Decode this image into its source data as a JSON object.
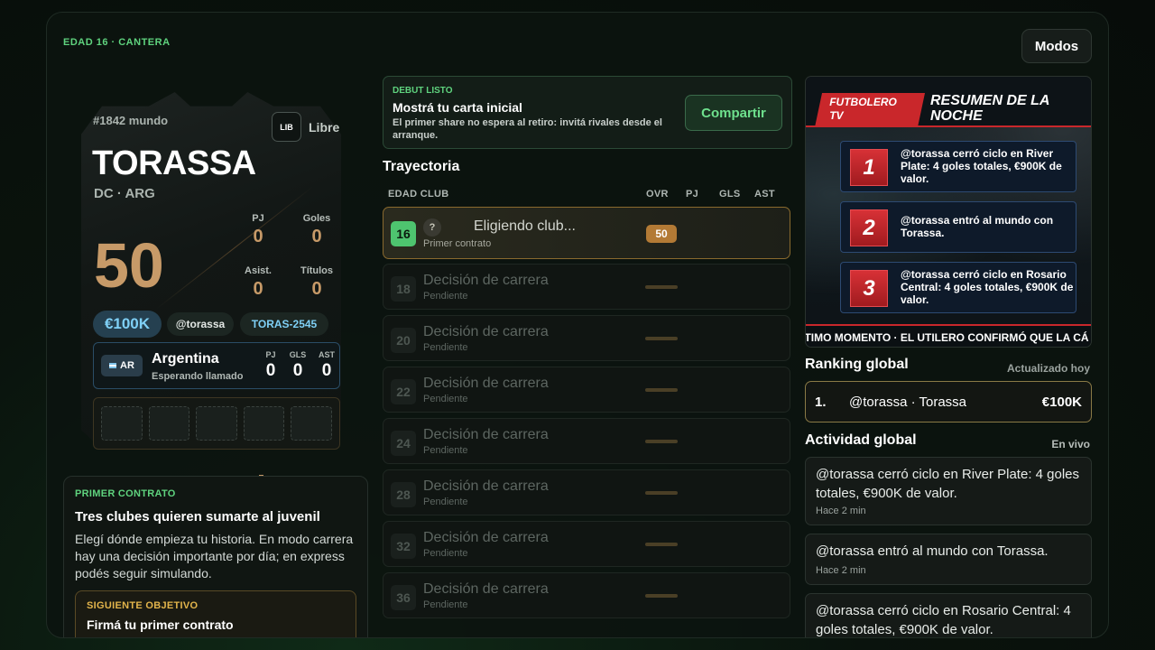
{
  "header": {
    "eyebrow": "EDAD 16 · CANTERA",
    "modes_label": "Modos"
  },
  "card": {
    "rank": "#1842 mundo",
    "position_badge": "LIB",
    "status": "Libre",
    "name": "TORASSA",
    "role_country": "DC · ARG",
    "overall": "50",
    "stats": [
      {
        "label": "PJ",
        "value": "0"
      },
      {
        "label": "Goles",
        "value": "0"
      },
      {
        "label": "Asist.",
        "value": "0"
      },
      {
        "label": "Títulos",
        "value": "0"
      }
    ],
    "value": "€100K",
    "handle": "@torassa",
    "code": "TORAS-2545",
    "nation": {
      "code": "AR",
      "name": "Argentina",
      "status": "Esperando llamado",
      "stats": [
        {
          "label": "PJ",
          "value": "0"
        },
        {
          "label": "GLS",
          "value": "0"
        },
        {
          "label": "AST",
          "value": "0"
        }
      ]
    }
  },
  "contract": {
    "tag": "PRIMER CONTRATO",
    "title": "Tres clubes quieren sumarte al juvenil",
    "text": "Elegí dónde empieza tu historia. En modo carrera hay una decisión importante por día; en express podés seguir simulando.",
    "objective_tag": "SIGUIENTE OBJETIVO",
    "objective_title": "Firmá tu primer contrato"
  },
  "debut": {
    "tag": "DEBUT LISTO",
    "title": "Mostrá tu carta inicial",
    "text": "El primer share no espera al retiro: invitá rivales desde el arranque.",
    "share_label": "Compartir"
  },
  "career": {
    "title": "Trayectoria",
    "columns": [
      "EDAD CLUB",
      "OVR",
      "PJ",
      "GLS",
      "AST"
    ],
    "rows": [
      {
        "age": "16",
        "club": "Eligiendo club...",
        "sub": "Primer contrato",
        "ovr": "50"
      },
      {
        "age": "18",
        "club": "Decisión de carrera",
        "sub": "Pendiente"
      },
      {
        "age": "20",
        "club": "Decisión de carrera",
        "sub": "Pendiente"
      },
      {
        "age": "22",
        "club": "Decisión de carrera",
        "sub": "Pendiente"
      },
      {
        "age": "24",
        "club": "Decisión de carrera",
        "sub": "Pendiente"
      },
      {
        "age": "28",
        "club": "Decisión de carrera",
        "sub": "Pendiente"
      },
      {
        "age": "32",
        "club": "Decisión de carrera",
        "sub": "Pendiente"
      },
      {
        "age": "36",
        "club": "Decisión de carrera",
        "sub": "Pendiente"
      }
    ]
  },
  "tv": {
    "brand": "FUTBOLERO TV",
    "title": "RESUMEN DE LA NOCHE",
    "items": [
      {
        "num": "1",
        "text": "@torassa cerró ciclo en River Plate: 4 goles totales, €900K de valor."
      },
      {
        "num": "2",
        "text": "@torassa entró al mundo con Torassa."
      },
      {
        "num": "3",
        "text": "@torassa cerró ciclo en Rosario Central: 4 goles totales, €900K de valor."
      }
    ],
    "ticker": "LTIMO MOMENTO · EL UTILERO CONFIRMÓ QUE LA CÁ"
  },
  "ranking": {
    "title": "Ranking global",
    "updated": "Actualizado hoy",
    "entries": [
      {
        "pos": "1.",
        "user": "@torassa · Torassa",
        "value": "€100K"
      }
    ]
  },
  "activity": {
    "title": "Actividad global",
    "live": "En vivo",
    "items": [
      {
        "text": "@torassa cerró ciclo en River Plate: 4 goles totales, €900K de valor.",
        "time": "Hace 2 min"
      },
      {
        "text": "@torassa entró al mundo con Torassa.",
        "time": "Hace 2 min"
      },
      {
        "text": "@torassa cerró ciclo en Rosario Central: 4 goles totales, €900K de valor.",
        "time": ""
      }
    ]
  },
  "colors": {
    "accent_green": "#5fd37e",
    "gold": "#c79a68",
    "tv_red": "#c9272b"
  }
}
